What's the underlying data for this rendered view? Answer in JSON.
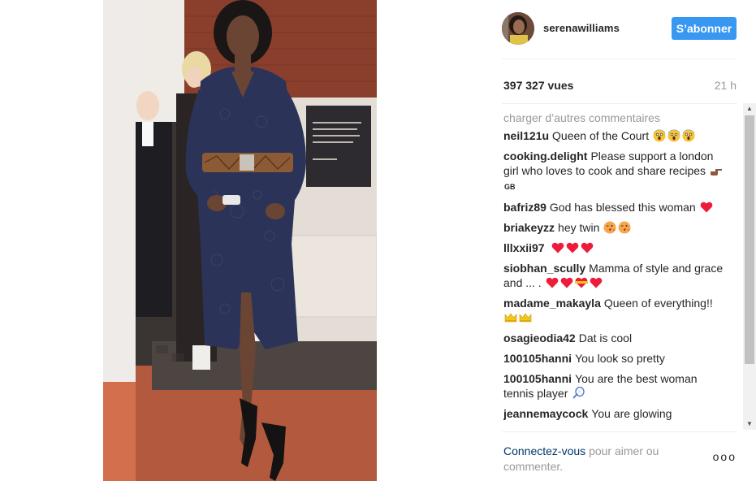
{
  "post": {
    "username": "serenawilliams",
    "follow_label": "S’abonner",
    "views": "397 327 vues",
    "time": "21 h"
  },
  "comments_section": {
    "load_more": "charger d’autres commentaires",
    "items": [
      {
        "author": "neil121u",
        "text": "Queen of the Court",
        "emojis": [
          "scream-face",
          "scream-face",
          "scream-face"
        ]
      },
      {
        "author": "cooking.delight",
        "text": "Please support a london girl who loves to cook and share recipes",
        "emojis": [
          "pointing-hand",
          "gb-flag"
        ],
        "flag_text": "GB"
      },
      {
        "author": "bafriz89",
        "text": "God has blessed this woman",
        "emojis": [
          "heart"
        ]
      },
      {
        "author": "briakeyzz",
        "text": "hey twin",
        "emojis": [
          "kiss-face",
          "kiss-face"
        ]
      },
      {
        "author": "lllxxii97",
        "text": "",
        "emojis": [
          "heart",
          "heart",
          "heart"
        ]
      },
      {
        "author": "siobhan_scully",
        "text": "Mamma of style and grace and ... .",
        "emojis": [
          "heart",
          "heart",
          "heart-ribbon",
          "heart"
        ]
      },
      {
        "author": "madame_makayla",
        "text": "Queen of everything!!",
        "emojis": [
          "crown",
          "crown"
        ]
      },
      {
        "author": "osagieodia42",
        "text": "Dat is cool",
        "emojis": []
      },
      {
        "author": "100105hanni",
        "text": "You look so pretty",
        "emojis": []
      },
      {
        "author": "100105hanni",
        "text": "You are the best woman tennis player",
        "emojis": [
          "tennis-racket"
        ]
      },
      {
        "author": "jeannemaycock",
        "text": "You are glowing",
        "emojis": []
      }
    ]
  },
  "footer": {
    "login_link": "Connectez-vous",
    "login_rest": "pour aimer ou commenter.",
    "more_label": "ooo"
  },
  "scrollbar": {
    "up": "▲",
    "down": "▼"
  },
  "colors": {
    "accent": "#3897f0",
    "heart": "#ed1c3a",
    "muted": "#999999",
    "dress": "#2c3358"
  }
}
